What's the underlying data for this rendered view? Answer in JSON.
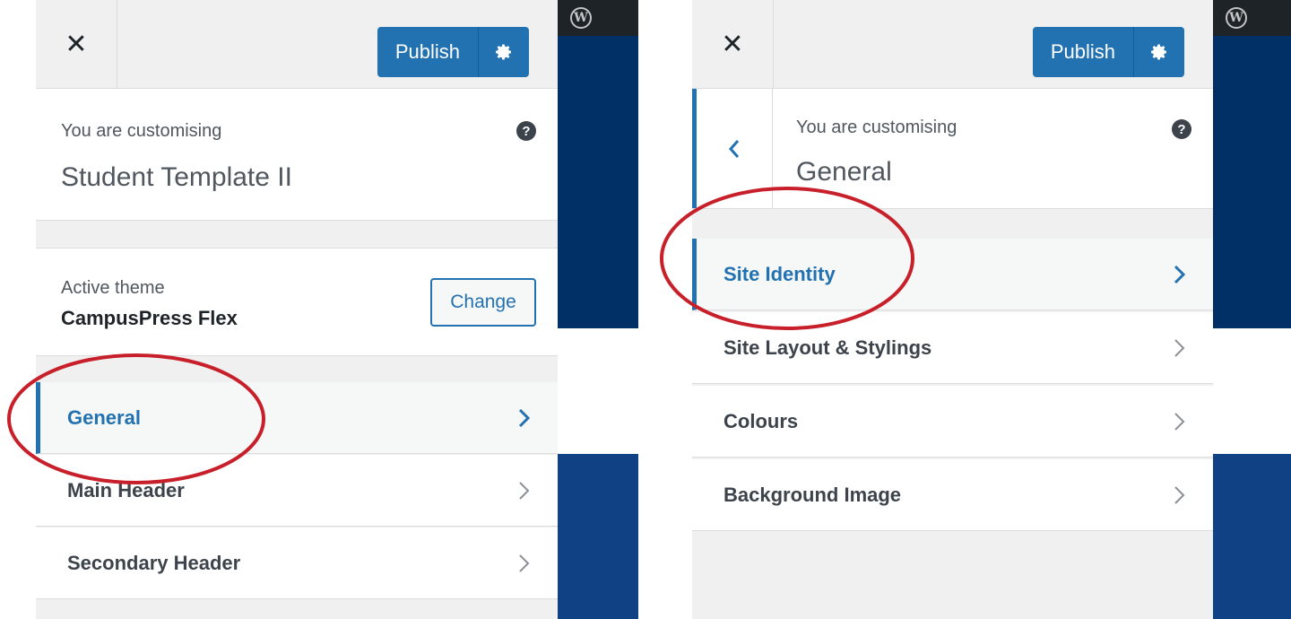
{
  "colors": {
    "accent": "#2271b1",
    "annotation": "#c8202a",
    "preview_dark": "#003066",
    "preview_mid": "#0f4184"
  },
  "left": {
    "close_icon": "close-icon",
    "publish_label": "Publish",
    "gear_icon": "gear-icon",
    "customizing_label": "You are customising",
    "customizing_title": "Student Template II",
    "help_icon": "help-icon",
    "theme_label": "Active theme",
    "theme_name": "CampusPress Flex",
    "change_label": "Change",
    "menu": [
      {
        "label": "General",
        "active": true
      },
      {
        "label": "Main Header",
        "active": false
      },
      {
        "label": "Secondary Header",
        "active": false
      }
    ]
  },
  "right": {
    "close_icon": "close-icon",
    "publish_label": "Publish",
    "gear_icon": "gear-icon",
    "back_icon": "chevron-left-icon",
    "customizing_label": "You are customising",
    "customizing_title": "General",
    "help_icon": "help-icon",
    "menu": [
      {
        "label": "Site Identity",
        "active": true
      },
      {
        "label": "Site Layout & Stylings",
        "active": false
      },
      {
        "label": "Colours",
        "active": false
      },
      {
        "label": "Background Image",
        "active": false
      }
    ]
  }
}
